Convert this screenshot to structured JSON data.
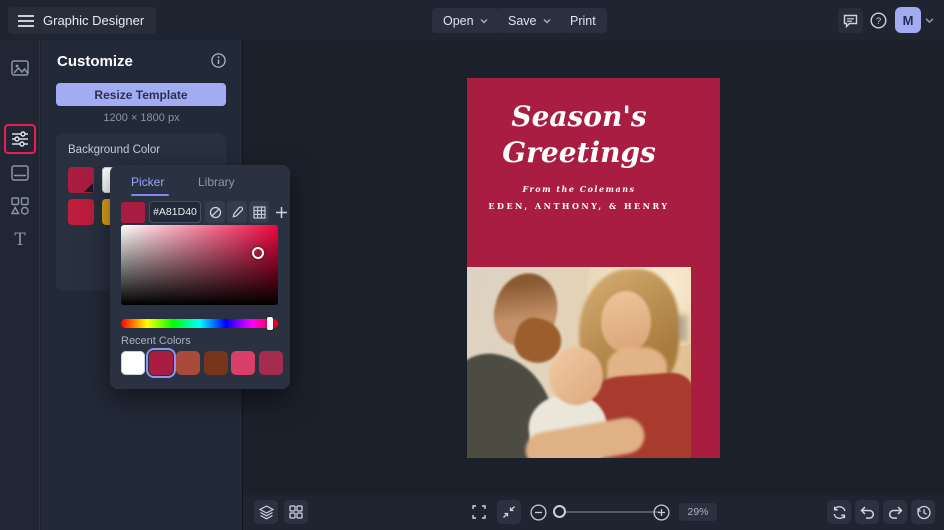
{
  "topbar": {
    "app_title": "Graphic Designer",
    "open_label": "Open",
    "save_label": "Save",
    "print_label": "Print",
    "avatar_initial": "M"
  },
  "panel": {
    "title": "Customize",
    "resize_button_label": "Resize Template",
    "template_size": "1200 × 1800 px",
    "background_color_label": "Background Color",
    "background_swatches": [
      "#A81D40",
      "#FFFFFF",
      "#BE1E3E",
      "#E3A51C"
    ]
  },
  "color_picker": {
    "picker_tab_label": "Picker",
    "library_tab_label": "Library",
    "hex_value": "#A81D40",
    "recent_colors_label": "Recent Colors",
    "recent_colors": [
      "#FFFFFF",
      "#A81D40",
      "#A84B3B",
      "#77351B",
      "#D94069",
      "#A62C4D"
    ],
    "selected_recent_color": "#A81D40"
  },
  "canvas": {
    "card": {
      "bg_color": "#A81D40",
      "title_line1": "Season's",
      "title_line2": "Greetings",
      "subtitle": "From the Colemans",
      "names_line": "EDEN, ANTHONY, & HENRY"
    }
  },
  "bottom_toolbar": {
    "zoom_level": "29%"
  },
  "colors": {
    "accent": "#A3ACF3",
    "active_tool_highlight": "#EE1C4E",
    "crimson": "#A81D40"
  }
}
